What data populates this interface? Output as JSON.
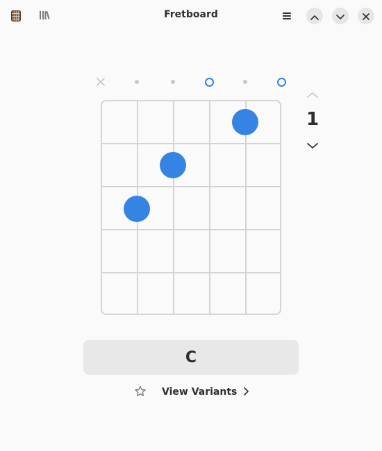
{
  "window": {
    "title": "Fretboard"
  },
  "header": {
    "app_icon": "guitar-neck-icon",
    "library_icon": "library-books-icon",
    "menu_icon": "hamburger-menu-icon",
    "up_icon": "chevron-up-icon",
    "down_icon": "chevron-down-icon",
    "close_icon": "close-icon"
  },
  "chord": {
    "name": "C",
    "fret_position": "1",
    "strings": [
      "muted",
      "fretted",
      "fretted",
      "open",
      "fretted",
      "open"
    ],
    "fingers": [
      {
        "string": 2,
        "fret": 3
      },
      {
        "string": 3,
        "fret": 2
      },
      {
        "string": 5,
        "fret": 1
      }
    ],
    "frets_shown": 5
  },
  "actions": {
    "star_icon": "star-outline-icon",
    "variants_label": "View Variants",
    "variants_icon": "chevron-right-icon"
  },
  "colors": {
    "accent": "#3584e4",
    "background": "#fafafa",
    "grid": "#d4d4d4",
    "entry_background": "#e8e8e8",
    "button_background": "#e6e6e6",
    "text": "#2e2e2e"
  }
}
